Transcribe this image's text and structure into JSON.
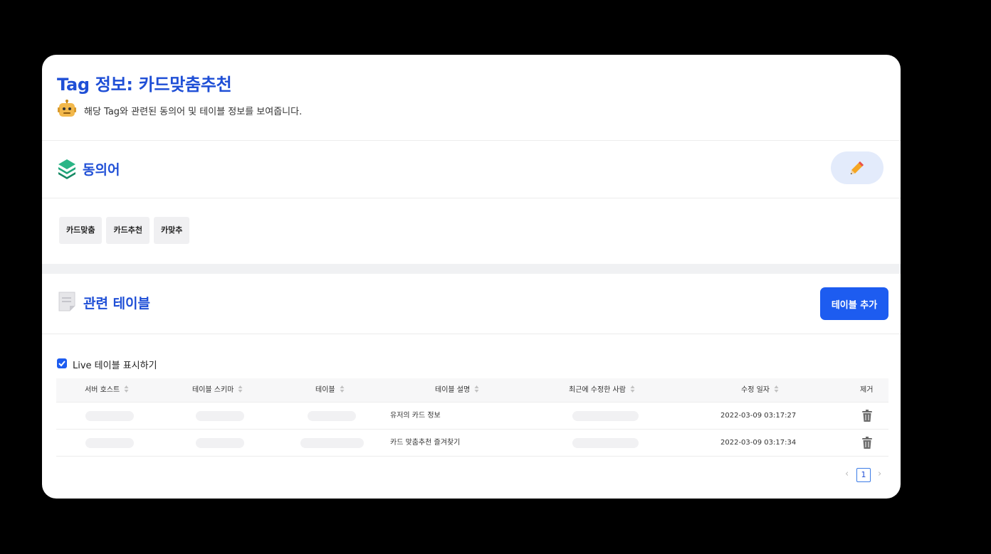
{
  "header": {
    "title": "Tag 정보: 카드맞춤추천",
    "subtitle": "해당 Tag와 관련된 동의어 및 테이블 정보를 보여줍니다."
  },
  "synonyms": {
    "title": "동의어",
    "chips": [
      "카드맞춤",
      "카드추천",
      "카맞추"
    ]
  },
  "related_tables": {
    "title": "관련 테이블",
    "add_button": "테이블 추가",
    "live_label": "Live 테이블 표시하기",
    "live_checked": true,
    "columns": [
      "서버 호스트",
      "테이블 스키마",
      "테이블",
      "테이블 설명",
      "최근에 수정한 사람",
      "수정 일자",
      "제거"
    ],
    "rows": [
      {
        "description": "유저의 카드 정보",
        "modified_at": "2022-03-09 03:17:27"
      },
      {
        "description": "카드 맞춤추천 즐겨찾기",
        "modified_at": "2022-03-09 03:17:34"
      }
    ],
    "pagination": {
      "current_page": "1",
      "prev": "‹",
      "next": "›"
    }
  },
  "colors": {
    "accent": "#1f4fd6",
    "button_primary": "#1d5cf0",
    "edit_button_bg": "#e3ebfb",
    "pencil": "#f5a623",
    "layers_icon": "#1fa67a"
  }
}
